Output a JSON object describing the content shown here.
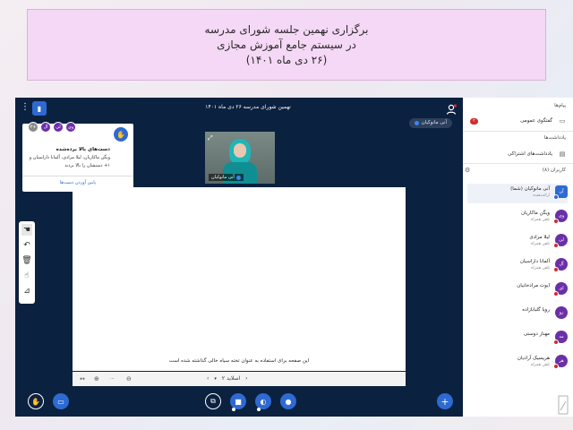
{
  "banner": {
    "line1": "برگزاری نهمین جلسه شورای مدرسه",
    "line2": "در سیستم جامع آموزش مجازی",
    "line3": "(۲۶ دی ماه ۱۴۰۱)"
  },
  "topbar": {
    "meeting_title": "نهمین شورای مدرسه ۲۶ دی ماه ۱۴۰۱",
    "logo_icon": "bbb-logo-icon",
    "users_icon": "user-list-icon"
  },
  "presenter": {
    "name": "آنی مانوکیان"
  },
  "hands_popup": {
    "title": "دست‌های بالا برده‌شده",
    "text": "ویگن ماکاریان، لیلا مرادی، آلمانا داراسیان و ۱+ دستشان را بالا بردند",
    "lower_button": "پایین آوردن دست‌ها",
    "avatars": [
      "وی",
      "لی",
      "آل",
      "۲+"
    ]
  },
  "webcam": {
    "name": "آنی مانوکیان"
  },
  "whiteboard": {
    "caption": "این صفحه برای استفاده به عنوان تخته سیاه خالی گذاشته شده است",
    "slide_label": "اسلاید ۲"
  },
  "sidebar": {
    "messages_header": "پیام‌ها",
    "public_chat": "گفتگوی عمومی",
    "public_chat_badge": "۳",
    "notes_header": "یادداشت‌ها",
    "shared_notes": "یادداشت‌های اشتراکی",
    "users_header": "کاربران (۸)",
    "users": [
      {
        "name": "آنی مانوکیان (شما)",
        "role": "ارائه‌دهنده",
        "avatar": "آن"
      },
      {
        "name": "ویگن ماکاریان",
        "role": "تلفن همراه",
        "avatar": "وی"
      },
      {
        "name": "لیلا مرادی",
        "role": "تلفن همراه",
        "avatar": "لی"
      },
      {
        "name": "آلمانا داراسیان",
        "role": "تلفن همراه",
        "avatar": "آل"
      },
      {
        "name": "ایوت مرادخانیان",
        "role": "",
        "avatar": "ای"
      },
      {
        "name": "رویا گلبابازاده",
        "role": "",
        "avatar": "رو"
      },
      {
        "name": "مهناز دوستی",
        "role": "",
        "avatar": "مه"
      },
      {
        "name": "هریسیک آرادیان",
        "role": "تلفن همراه",
        "avatar": "هر"
      }
    ]
  }
}
